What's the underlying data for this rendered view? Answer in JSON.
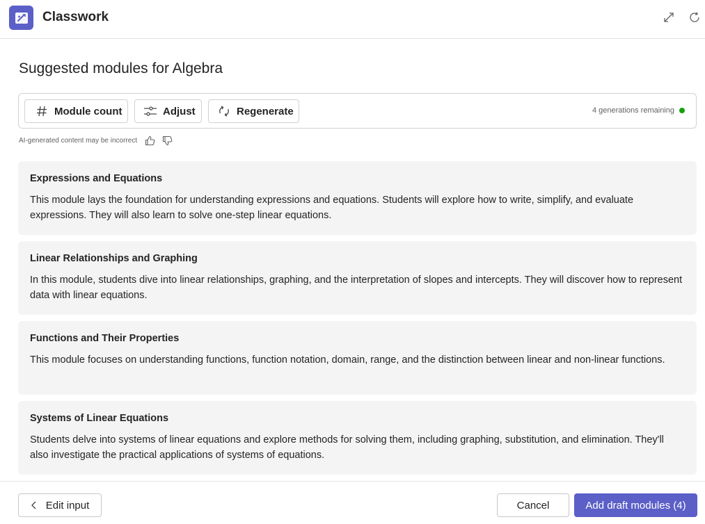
{
  "app": {
    "title": "Classwork"
  },
  "page": {
    "title": "Suggested modules for Algebra"
  },
  "toolbar": {
    "module_count_label": "Module count",
    "adjust_label": "Adjust",
    "regenerate_label": "Regenerate",
    "generations_remaining": "4 generations remaining",
    "status_color": "#13a10e"
  },
  "disclaimer": "AI-generated content may be incorrect",
  "modules": [
    {
      "title": "Expressions and Equations",
      "description": "This module lays the foundation for understanding expressions and equations. Students will explore how to write, simplify, and evaluate expressions. They will also learn to solve one-step linear equations."
    },
    {
      "title": "Linear Relationships and Graphing",
      "description": "In this module, students dive into linear relationships, graphing, and the interpretation of slopes and intercepts. They will discover how to represent data with linear equations."
    },
    {
      "title": "Functions and Their Properties",
      "description": "This module focuses on understanding functions, function notation, domain, range, and the distinction between linear and non-linear functions."
    },
    {
      "title": "Systems of Linear Equations",
      "description": "Students delve into systems of linear equations and explore methods for solving them, including graphing, substitution, and elimination. They'll also investigate the practical applications of systems of equations."
    }
  ],
  "footer": {
    "edit_input_label": "Edit input",
    "cancel_label": "Cancel",
    "add_label": "Add draft modules (4)"
  },
  "colors": {
    "brand": "#5b5fc7"
  },
  "icons": {
    "app": "classwork-icon",
    "expand": "expand-icon",
    "refresh": "refresh-icon",
    "module_count": "hash-icon",
    "adjust": "sliders-icon",
    "regenerate": "regenerate-icon",
    "like": "thumbs-up-icon",
    "dislike": "thumbs-down-icon",
    "back": "chevron-left-icon"
  }
}
